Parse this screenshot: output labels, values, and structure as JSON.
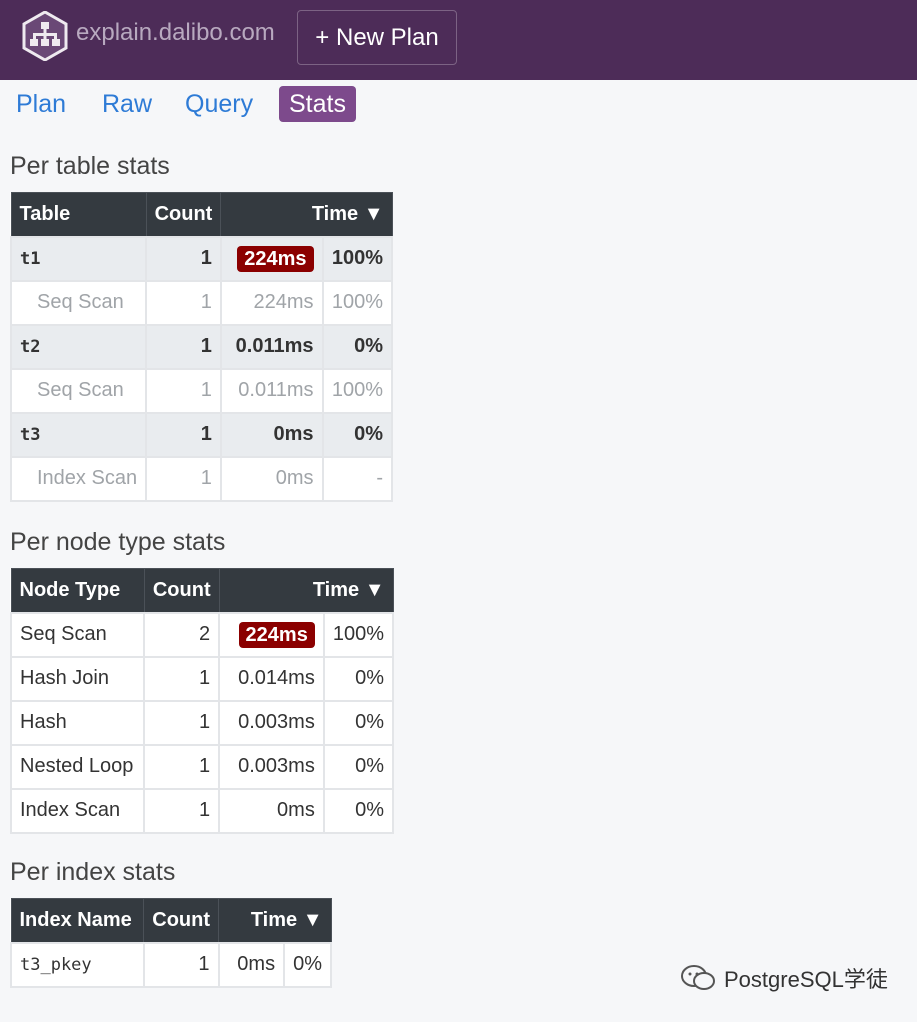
{
  "header": {
    "brand": "explain.dalibo.com",
    "new_plan_label": "+ New Plan"
  },
  "tabs": [
    {
      "label": "Plan",
      "active": false
    },
    {
      "label": "Raw",
      "active": false
    },
    {
      "label": "Query",
      "active": false
    },
    {
      "label": "Stats",
      "active": true
    }
  ],
  "table_stats": {
    "title": "Per table stats",
    "headers": [
      "Table",
      "Count",
      "Time ▼"
    ],
    "rows": [
      {
        "name": "t1",
        "count": "1",
        "time": "224ms",
        "pct": "100%",
        "kind": "group",
        "highlight": true
      },
      {
        "name": "Seq Scan",
        "count": "1",
        "time": "224ms",
        "pct": "100%",
        "kind": "sub"
      },
      {
        "name": "t2",
        "count": "1",
        "time": "0.011ms",
        "pct": "0%",
        "kind": "group"
      },
      {
        "name": "Seq Scan",
        "count": "1",
        "time": "0.011ms",
        "pct": "100%",
        "kind": "sub"
      },
      {
        "name": "t3",
        "count": "1",
        "time": "0ms",
        "pct": "0%",
        "kind": "group"
      },
      {
        "name": "Index Scan",
        "count": "1",
        "time": "0ms",
        "pct": "-",
        "kind": "sub"
      }
    ]
  },
  "node_stats": {
    "title": "Per node type stats",
    "headers": [
      "Node Type",
      "Count",
      "Time ▼"
    ],
    "rows": [
      {
        "name": "Seq Scan",
        "count": "2",
        "time": "224ms",
        "pct": "100%",
        "highlight": true
      },
      {
        "name": "Hash Join",
        "count": "1",
        "time": "0.014ms",
        "pct": "0%"
      },
      {
        "name": "Hash",
        "count": "1",
        "time": "0.003ms",
        "pct": "0%"
      },
      {
        "name": "Nested Loop",
        "count": "1",
        "time": "0.003ms",
        "pct": "0%"
      },
      {
        "name": "Index Scan",
        "count": "1",
        "time": "0ms",
        "pct": "0%"
      }
    ]
  },
  "index_stats": {
    "title": "Per index stats",
    "headers": [
      "Index Name",
      "Count",
      "Time ▼"
    ],
    "rows": [
      {
        "name": "t3_pkey",
        "count": "1",
        "time": "0ms",
        "pct": "0%"
      }
    ]
  },
  "watermark": "PostgreSQL学徒",
  "colors": {
    "navbar": "#4d2c58",
    "active_tab": "#7d4a8c",
    "badge": "#8b0000",
    "link": "#2e7bd6"
  }
}
